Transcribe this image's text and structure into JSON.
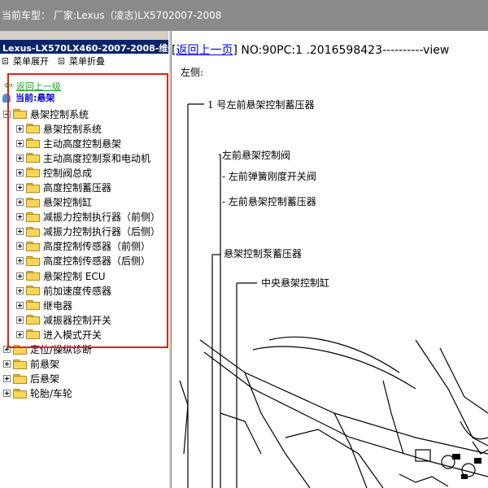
{
  "title_bar": {
    "text": "当前车型： 厂家:Lexus（凌志)LX5702007-2008"
  },
  "left_pane": {
    "header": "Lexus-LX570LX460-2007-2008-维修",
    "expand_label": "菜单展开",
    "collapse_label": "菜单折叠",
    "back_label": "返回上一级",
    "current_label": "当前:悬架",
    "tree": {
      "root": "悬架控制系统",
      "children": [
        "悬架控制系统",
        "主动高度控制悬架",
        "主动高度控制泵和电动机",
        "控制阀总成",
        "高度控制蓄压器",
        "悬架控制缸",
        "减振力控制执行器（前侧）",
        "减振力控制执行器（后侧）",
        "高度控制传感器（前侧）",
        "高度控制传感器（后侧）",
        "悬架控制 ECU",
        "前加速度传感器",
        "继电器",
        "减振器控制开关",
        "进入模式开关"
      ],
      "siblings": [
        "定位/操纵诊断",
        "前悬架",
        "后悬架",
        "轮胎/车轮"
      ]
    }
  },
  "right_pane": {
    "back_link": "返回上一页",
    "doc_number": "] NO:90PC:1 .2016598423----------view",
    "side_label": "左侧:",
    "annotations": [
      "1 号左前悬架控制蓄压器",
      "左前悬架控制阀",
      "- 左前弹簧刚度开关阀",
      "- 左前悬架控制蓄压器",
      "悬架控制泵蓄压器",
      "中央悬架控制缸"
    ]
  },
  "colors": {
    "header_bg": "#0a246a",
    "title_bg": "#8a8a8a",
    "highlight_border": "#e0221a",
    "link_green": "#21a321"
  }
}
